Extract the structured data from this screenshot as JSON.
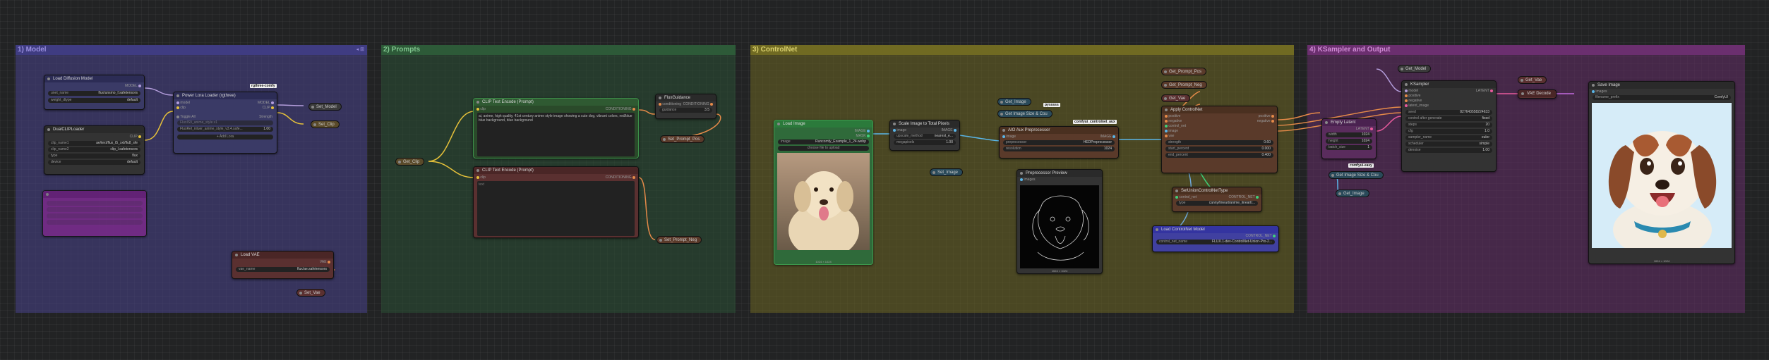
{
  "colors": {
    "group_model": "#3c3a6e",
    "group_prompts": "#2f4a37",
    "group_controlnet": "#5f5a22",
    "group_ksampler": "#5a2c5d",
    "wire_yellow": "#e6c13a",
    "wire_orange": "#e58a49",
    "wire_purple": "#c36ae0",
    "wire_blue": "#5ab6e8",
    "wire_pink": "#e85a9d",
    "node_red": "#5a3030",
    "node_green": "#2f6a3a",
    "node_blue": "#4040a0"
  },
  "groups": {
    "model": {
      "title": "1) Model",
      "icons": "◂ ⊞"
    },
    "prompts": {
      "title": "2) Prompts"
    },
    "controlnet": {
      "title": "3) ControlNet"
    },
    "ksampler": {
      "title": "4) KSampler and Output"
    }
  },
  "nodes": {
    "load_diffusion": {
      "title": "Load Diffusion Model",
      "out_model": "MODEL",
      "w1_label": "unet_name",
      "w1_value": "flux/unsmo_f.safetensors",
      "w2_label": "weight_dtype",
      "w2_value": "default"
    },
    "dual_clip": {
      "title": "DualCLIPLoader",
      "out_clip": "CLIP",
      "w1_label": "clip_name1",
      "w1_value": "ae/text/flux_t5_xxl/flu8_sfe",
      "w2_label": "clip_name2",
      "w2_value": "clip_l.safetensors",
      "w3_label": "type",
      "w3_value": "flux",
      "w4_label": "device",
      "w4_value": "default"
    },
    "lora_loader": {
      "title": "Power Lora Loader (rgthree)",
      "badge": "rgthree-comfy",
      "in_model": "model",
      "in_clip": "clip",
      "out_model": "MODEL",
      "out_clip": "CLIP",
      "toggle_label": "Toggle All",
      "strength_label": "Strength",
      "lora1": "FluxIS9_anime_style.v1",
      "lora2": "FluxRel_niluer_anime_style_v3.4.safe...",
      "lora2_value": "1.00",
      "add_lora": "+ Add Lora"
    },
    "load_vae": {
      "title": "Load VAE",
      "out_vae": "VAE",
      "w1_label": "vae_name",
      "w1_value": "flux/ae.safetensors"
    },
    "clip_pos": {
      "title": "CLIP Text Encode (Prompt)",
      "in_clip": "clip",
      "out": "CONDITIONING",
      "text": "ai, anime, high quality, 41st century anime style image showing a cute dog, vibrant colors, red/blue blue background, blue background"
    },
    "clip_neg": {
      "title": "CLIP Text Encode (Prompt)",
      "in_clip": "clip",
      "out": "CONDITIONING",
      "text": "text"
    },
    "flux_guidance": {
      "title": "FluxGuidance",
      "in": "conditioning",
      "out": "CONDITIONING",
      "w1_label": "guidance",
      "w1_value": "3.5"
    },
    "load_image": {
      "title": "Load Image",
      "out_image": "IMAGE",
      "out_mask": "MASK",
      "w1_label": "image",
      "w1_value": "Runcomfy_Example_1_24.webp",
      "upload": "choose file to upload",
      "caption": "1024 × 1024"
    },
    "scale_image": {
      "title": "Scale Image to Total Pixels",
      "in_image": "image",
      "out_image": "IMAGE",
      "w1_label": "upscale_method",
      "w1_value": "nearest_e...",
      "w2_label": "megapixels",
      "w2_value": "1.00"
    },
    "aio_pre": {
      "title": "AIO Aux Preprocessor",
      "badge": "comfyui_controlnet_aux",
      "in_image": "image",
      "out_image": "IMAGE",
      "w1_label": "preprocessor",
      "w1_value": "HEDPreprocessor",
      "w2_label": "resolution",
      "w2_value": "1024"
    },
    "preprocessor_preview": {
      "title": "Preprocessor Preview",
      "in_images": "images",
      "caption": "1024 × 1024"
    },
    "apply_controlnet": {
      "title": "Apply ControlNet",
      "in_positive": "positive",
      "in_negative": "negative",
      "in_controlnet": "control_net",
      "in_image": "image",
      "in_vae": "vae",
      "out_positive": "positive",
      "out_negative": "negative",
      "w1_label": "strength",
      "w1_value": "0.60",
      "w2_label": "start_percent",
      "w2_value": "0.000",
      "w3_label": "end_percent",
      "w3_value": "0.400"
    },
    "set_union": {
      "title": "SetUnionControlNetType",
      "in": "control_net",
      "out": "CONTROL_NET",
      "w1_label": "type",
      "w1_value": "canny/lineart/anime_lineart/..."
    },
    "load_controlnet": {
      "title": "Load ControlNet Model",
      "out": "CONTROL_NET",
      "w1_label": "control_net_name",
      "w1_value": "FLUX.1-dev-ControlNet-Union-Pro-2..."
    },
    "empty_latent": {
      "title": "Empty Latent",
      "out": "LATENT",
      "w1_label": "width",
      "w1_value": "1024",
      "w2_label": "height",
      "w2_value": "1024",
      "w3_label": "batch_size",
      "w3_value": "1"
    },
    "ksampler": {
      "title": "KSampler",
      "in_model": "model",
      "in_positive": "positive",
      "in_negative": "negative",
      "in_latent": "latent_image",
      "out": "LATENT",
      "w1_label": "seed",
      "w1_value": "827643558224633",
      "w2_label": "control after generate",
      "w2_value": "fixed",
      "w3_label": "steps",
      "w3_value": "20",
      "w4_label": "cfg",
      "w4_value": "1.0",
      "w5_label": "sampler_name",
      "w5_value": "euler",
      "w6_label": "scheduler",
      "w6_value": "simple",
      "w7_label": "denoise",
      "w7_value": "1.00"
    },
    "vae_decode": {
      "title": "VAE Decode"
    },
    "save_image": {
      "title": "Save Image",
      "in_images": "images",
      "w1_label": "filename_prefix",
      "w1_value": "ComfyUI",
      "caption": "1024 × 1024"
    }
  },
  "small_nodes": {
    "set_model": "Set_Model",
    "set_clip": "Set_Clip",
    "set_vae": "Set_Vae",
    "get_clip": "Get_Clip",
    "set_prompt_pos": "Set_Prompt_Pos",
    "set_prompt_neg": "Set_Prompt_Neg",
    "get_image": "Get_Image",
    "get_image_size": "Get Image Size & Cou",
    "badge_pysssss": "pysssss",
    "set_image": "Set_Image",
    "get_prompt_pos": "Get_Prompt_Pos",
    "get_prompt_neg": "Get_Prompt_Neg",
    "get_vae": "Get_Vae",
    "get_model": "Get_Model",
    "get_vae2": "Get_Vae",
    "get_image_size2": "Get Image Size & Cou",
    "badge_comfyui_easy": "comfyui-easy",
    "get_image2": "Get_Image"
  }
}
